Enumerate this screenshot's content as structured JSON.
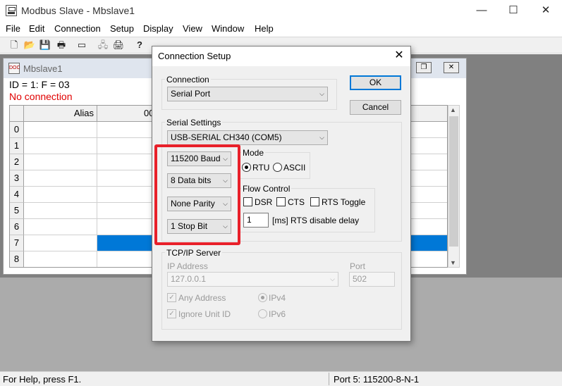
{
  "app": {
    "title": "Modbus Slave - Mbslave1",
    "window_buttons": {
      "minimize": "—",
      "maximize": "☐",
      "close": "✕"
    }
  },
  "menu": [
    "File",
    "Edit",
    "Connection",
    "Setup",
    "Display",
    "View",
    "Window",
    "Help"
  ],
  "toolbar": {
    "icons": [
      "new-file-icon",
      "open-folder-icon",
      "save-icon",
      "print-icon",
      "window-icon",
      "connect-icon",
      "disconnect-icon",
      "help-icon",
      "context-help-icon"
    ],
    "glyphs": [
      "🗋",
      "📂",
      "💾",
      "🖶",
      "▭",
      "🖧",
      "🖨",
      "?",
      "⁇"
    ]
  },
  "child_window": {
    "title": "Mbslave1",
    "icon_text": "DOC",
    "buttons": {
      "minimize": "—",
      "restore": "❐",
      "close": "✕"
    },
    "info_line1": "ID = 1: F = 03",
    "info_line2": "No connection",
    "columns": [
      "Alias",
      "00"
    ],
    "rows": [
      "0",
      "1",
      "2",
      "3",
      "4",
      "5",
      "6",
      "7",
      "8"
    ],
    "selected_row": "7",
    "scroll_up": "▲",
    "scroll_down": "▼"
  },
  "dialog": {
    "title": "Connection Setup",
    "close": "✕",
    "connection_group": "Connection",
    "connection_value": "Serial Port",
    "ok_label": "OK",
    "cancel_label": "Cancel",
    "serial_group": "Serial Settings",
    "port_value": "USB-SERIAL CH340 (COM5)",
    "baud_value": "115200 Baud",
    "databits_value": "8 Data bits",
    "parity_value": "None Parity",
    "stopbits_value": "1 Stop Bit",
    "mode_group": "Mode",
    "mode_options": [
      "RTU",
      "ASCII"
    ],
    "mode_selected": "RTU",
    "flow_group": "Flow Control",
    "flow_options": [
      "DSR",
      "CTS",
      "RTS Toggle"
    ],
    "rts_delay_value": "1",
    "rts_delay_label": "[ms] RTS disable delay",
    "tcp_group": "TCP/IP Server",
    "ip_label": "IP Address",
    "ip_value": "127.0.0.1",
    "port_label": "Port",
    "port_number": "502",
    "any_address_label": "Any Address",
    "ignore_unit_label": "Ignore Unit ID",
    "ipv4_label": "IPv4",
    "ipv6_label": "IPv6",
    "dropdown_arrow": "⌵"
  },
  "status": {
    "help": "For Help, press F1.",
    "port": "Port 5: 115200-8-N-1"
  },
  "colors": {
    "highlight": "#e8202a",
    "selected_cell": "#0078d7",
    "error_text": "#e00000",
    "mdi_background": "#808080"
  }
}
